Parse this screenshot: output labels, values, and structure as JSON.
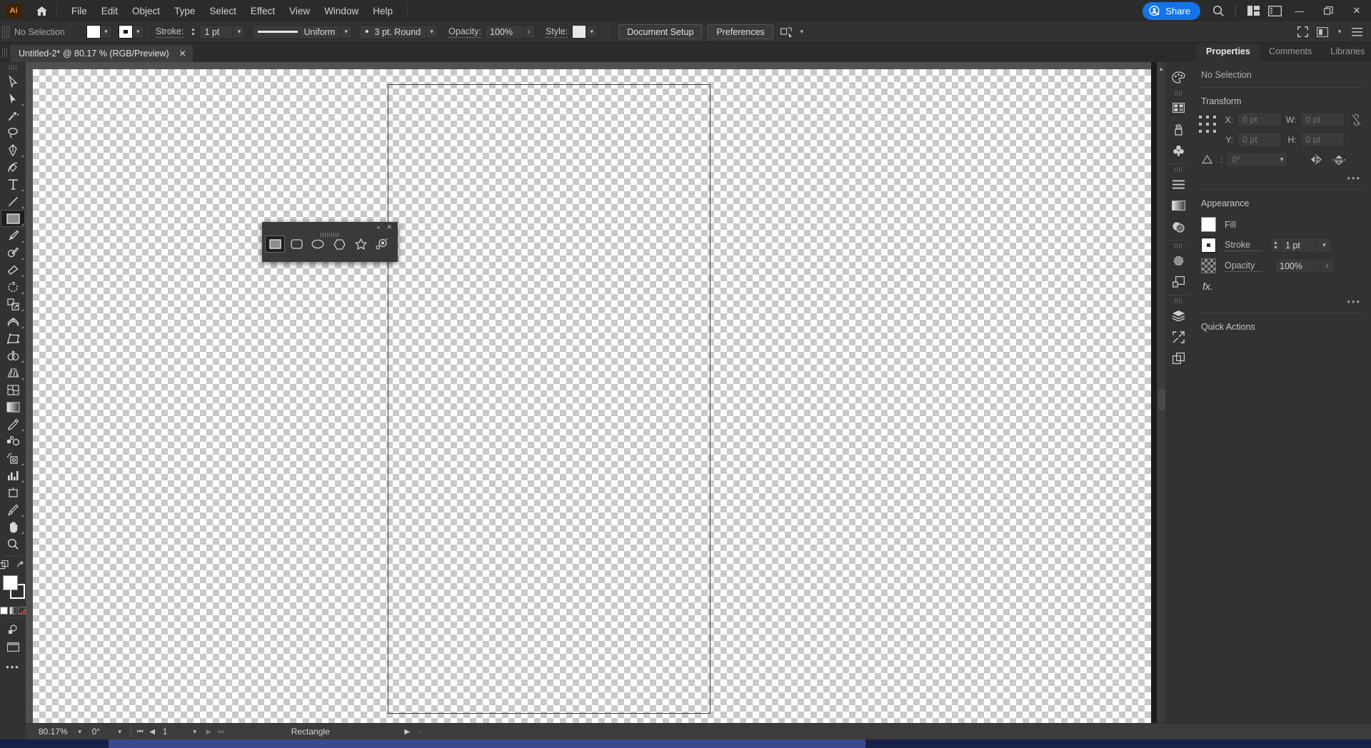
{
  "app": {
    "name": "Adobe Illustrator",
    "logo_text": "Ai"
  },
  "menubar": {
    "items": [
      {
        "label": "File"
      },
      {
        "label": "Edit"
      },
      {
        "label": "Object"
      },
      {
        "label": "Type"
      },
      {
        "label": "Select"
      },
      {
        "label": "Effect"
      },
      {
        "label": "View"
      },
      {
        "label": "Window"
      },
      {
        "label": "Help"
      }
    ],
    "share_label": "Share",
    "window_buttons": {
      "minimize": "—",
      "maximize": "❐",
      "close": "✕"
    }
  },
  "controlbar": {
    "selection_status": "No Selection",
    "stroke_label": "Stroke:",
    "stroke_weight": "1 pt",
    "stroke_profile": "Uniform",
    "brush_definition": "3 pt. Round",
    "opacity_label": "Opacity:",
    "opacity_value": "100%",
    "style_label": "Style:",
    "document_setup_label": "Document Setup",
    "preferences_label": "Preferences"
  },
  "tabs": {
    "documents": [
      {
        "title": "Untitled-2* @ 80.17 % (RGB/Preview)",
        "close": "✕",
        "active": true
      }
    ]
  },
  "toolbar": {
    "tools": [
      {
        "name": "selection-tool",
        "label": "Selection",
        "active": false,
        "flyout": false
      },
      {
        "name": "direct-selection-tool",
        "label": "Direct Selection",
        "active": false,
        "flyout": true
      },
      {
        "name": "magic-wand-tool",
        "label": "Magic Wand",
        "active": false,
        "flyout": false
      },
      {
        "name": "lasso-tool",
        "label": "Lasso",
        "active": false,
        "flyout": false
      },
      {
        "name": "pen-tool",
        "label": "Pen",
        "active": false,
        "flyout": true
      },
      {
        "name": "curvature-tool",
        "label": "Curvature",
        "active": false,
        "flyout": false
      },
      {
        "name": "type-tool",
        "label": "Type",
        "active": false,
        "flyout": true
      },
      {
        "name": "line-segment-tool",
        "label": "Line Segment",
        "active": false,
        "flyout": true
      },
      {
        "name": "rectangle-tool",
        "label": "Rectangle",
        "active": true,
        "flyout": true
      },
      {
        "name": "paintbrush-tool",
        "label": "Paintbrush",
        "active": false,
        "flyout": true
      },
      {
        "name": "shaper-tool",
        "label": "Shaper",
        "active": false,
        "flyout": true
      },
      {
        "name": "eraser-tool",
        "label": "Eraser",
        "active": false,
        "flyout": true
      },
      {
        "name": "rotate-tool",
        "label": "Rotate",
        "active": false,
        "flyout": true
      },
      {
        "name": "scale-tool",
        "label": "Scale",
        "active": false,
        "flyout": true
      },
      {
        "name": "width-tool",
        "label": "Width",
        "active": false,
        "flyout": true
      },
      {
        "name": "free-transform-tool",
        "label": "Free Transform",
        "active": false,
        "flyout": false
      },
      {
        "name": "shape-builder-tool",
        "label": "Shape Builder",
        "active": false,
        "flyout": true
      },
      {
        "name": "perspective-grid-tool",
        "label": "Perspective Grid",
        "active": false,
        "flyout": true
      },
      {
        "name": "mesh-tool",
        "label": "Mesh",
        "active": false,
        "flyout": false
      },
      {
        "name": "gradient-tool",
        "label": "Gradient",
        "active": false,
        "flyout": false
      },
      {
        "name": "eyedropper-tool",
        "label": "Eyedropper",
        "active": false,
        "flyout": true
      },
      {
        "name": "blend-tool",
        "label": "Blend",
        "active": false,
        "flyout": false
      },
      {
        "name": "symbol-sprayer-tool",
        "label": "Symbol Sprayer",
        "active": false,
        "flyout": true
      },
      {
        "name": "column-graph-tool",
        "label": "Column Graph",
        "active": false,
        "flyout": true
      },
      {
        "name": "artboard-tool",
        "label": "Artboard",
        "active": false,
        "flyout": false
      },
      {
        "name": "slice-tool",
        "label": "Slice",
        "active": false,
        "flyout": true
      },
      {
        "name": "hand-tool",
        "label": "Hand",
        "active": false,
        "flyout": true
      },
      {
        "name": "zoom-tool",
        "label": "Zoom",
        "active": false,
        "flyout": false
      }
    ],
    "fill_color": "#ffffff",
    "stroke_color": "#ffffff",
    "color_modes": [
      "color",
      "gradient",
      "none"
    ]
  },
  "shape_flyout": {
    "title_hidden": true,
    "collapse_icon": "«",
    "close_icon": "✕",
    "tools": [
      {
        "name": "rectangle-tool",
        "label": "Rectangle",
        "selected": true
      },
      {
        "name": "rounded-rectangle-tool",
        "label": "Rounded Rectangle",
        "selected": false
      },
      {
        "name": "ellipse-tool",
        "label": "Ellipse",
        "selected": false
      },
      {
        "name": "polygon-tool",
        "label": "Polygon",
        "selected": false
      },
      {
        "name": "star-tool",
        "label": "Star",
        "selected": false
      },
      {
        "name": "flare-tool",
        "label": "Flare",
        "selected": false
      }
    ]
  },
  "properties_panel": {
    "tabs": [
      {
        "label": "Properties",
        "active": true
      },
      {
        "label": "Comments",
        "active": false
      },
      {
        "label": "Libraries",
        "active": false
      }
    ],
    "selection_status": "No Selection",
    "transform": {
      "title": "Transform",
      "x_label": "X:",
      "x_value": "0 pt",
      "y_label": "Y:",
      "y_value": "0 pt",
      "w_label": "W:",
      "w_value": "0 pt",
      "h_label": "H:",
      "h_value": "0 pt",
      "angle_label": "∠:",
      "angle_value": "0°",
      "more_options": "•••"
    },
    "appearance": {
      "title": "Appearance",
      "fill_label": "Fill",
      "stroke_label": "Stroke",
      "stroke_weight": "1 pt",
      "opacity_label": "Opacity",
      "opacity_value": "100%",
      "fx_label": "fx.",
      "more_options": "•••"
    },
    "quick_actions": {
      "title": "Quick Actions"
    }
  },
  "dock_rail": {
    "items": [
      {
        "name": "color-panel-icon",
        "label": "Color"
      },
      {
        "name": "swatches-panel-icon",
        "label": "Swatches"
      },
      {
        "name": "brushes-panel-icon",
        "label": "Brushes"
      },
      {
        "name": "symbols-panel-icon",
        "label": "Symbols"
      },
      {
        "name": "align-panel-icon",
        "label": "Align"
      },
      {
        "name": "gradient-panel-icon",
        "label": "Gradient"
      },
      {
        "name": "transparency-panel-icon",
        "label": "Transparency"
      },
      {
        "name": "appearance-panel-icon",
        "label": "Appearance"
      },
      {
        "name": "pathfinder-panel-icon",
        "label": "Pathfinder"
      },
      {
        "name": "layers-panel-icon",
        "label": "Layers"
      },
      {
        "name": "asset-export-panel-icon",
        "label": "Asset Export"
      },
      {
        "name": "artboards-panel-icon",
        "label": "Artboards"
      }
    ]
  },
  "statusbar": {
    "zoom_level": "80.17%",
    "rotation": "0°",
    "artboard_number": "1",
    "status_text": "Rectangle"
  },
  "colors": {
    "accent_blue": "#1473e6",
    "panel_bg": "#323232",
    "menu_bg": "#2b2b2b",
    "canvas_bg": "#505050",
    "artboard_border": "#3b3b3b",
    "text": "#c8c8c8"
  }
}
